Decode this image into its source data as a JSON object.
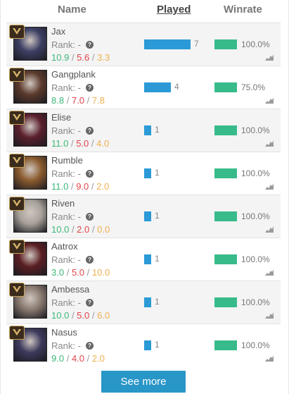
{
  "header": {
    "name_label": "Name",
    "played_label": "Played",
    "winrate_label": "Winrate"
  },
  "colors": {
    "played_bar": "#2b9ad6",
    "winrate_bar": "#38bb8a",
    "kills": "#3cb878",
    "deaths": "#e0454b",
    "assists": "#f0b050",
    "button": "#2996c8"
  },
  "rows": [
    {
      "name": "Jax",
      "rank": "Rank: -",
      "k": "10.9",
      "d": "5.6",
      "a": "3.3",
      "played": "7",
      "winrate": "100.0%",
      "portrait": "#3c3f63"
    },
    {
      "name": "Gangplank",
      "rank": "Rank: -",
      "k": "8.8",
      "d": "7.0",
      "a": "7.8",
      "played": "4",
      "winrate": "75.0%",
      "portrait": "#5b3a2c"
    },
    {
      "name": "Elise",
      "rank": "Rank: -",
      "k": "11.0",
      "d": "5.0",
      "a": "4.0",
      "played": "1",
      "winrate": "100.0%",
      "portrait": "#5a1f2c"
    },
    {
      "name": "Rumble",
      "rank": "Rank: -",
      "k": "11.0",
      "d": "9.0",
      "a": "2.0",
      "played": "1",
      "winrate": "100.0%",
      "portrait": "#8a5b2e"
    },
    {
      "name": "Riven",
      "rank": "Rank: -",
      "k": "10.0",
      "d": "2.0",
      "a": "0.0",
      "played": "1",
      "winrate": "100.0%",
      "portrait": "#a8a29a"
    },
    {
      "name": "Aatrox",
      "rank": "Rank: -",
      "k": "3.0",
      "d": "5.0",
      "a": "10.0",
      "played": "1",
      "winrate": "100.0%",
      "portrait": "#5b1e22"
    },
    {
      "name": "Ambessa",
      "rank": "Rank: -",
      "k": "10.0",
      "d": "5.0",
      "a": "6.0",
      "played": "1",
      "winrate": "100.0%",
      "portrait": "#8a7a70"
    },
    {
      "name": "Nasus",
      "rank": "Rank: -",
      "k": "9.0",
      "d": "4.0",
      "a": "2.0",
      "played": "1",
      "winrate": "100.0%",
      "portrait": "#3c3a5c"
    }
  ],
  "played_max": 7,
  "icons": {
    "rank_badge": "rank-emblem-icon",
    "help": "help-circle-icon",
    "trend": "trend-chart-icon"
  },
  "see_more_label": "See more"
}
